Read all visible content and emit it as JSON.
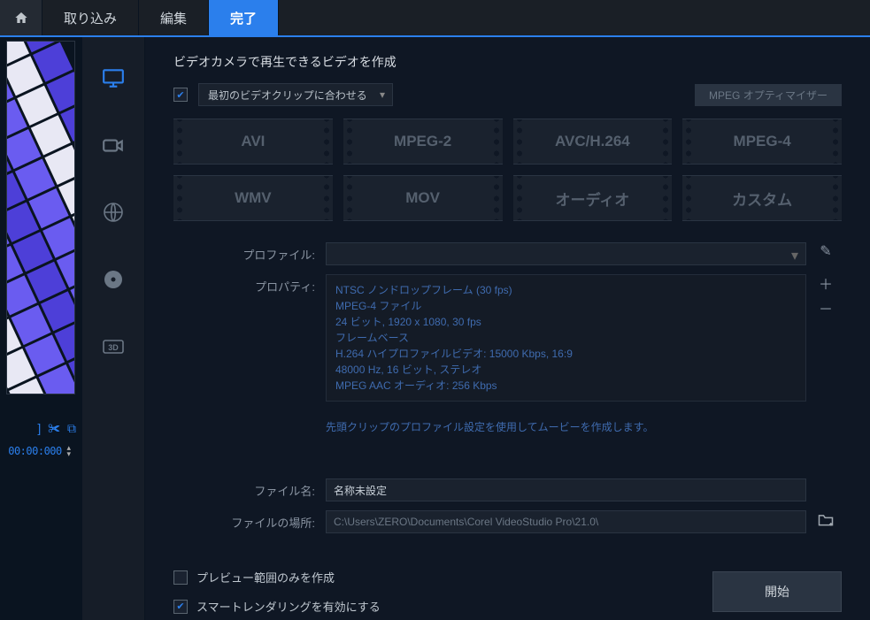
{
  "tabs": {
    "import": "取り込み",
    "edit": "編集",
    "finish": "完了"
  },
  "heading": "ビデオカメラで再生できるビデオを作成",
  "match_clip": {
    "label": "最初のビデオクリップに合わせる",
    "checked": true
  },
  "mpeg_opt": "MPEG オプティマイザー",
  "formats": [
    "AVI",
    "MPEG-2",
    "AVC/H.264",
    "MPEG-4",
    "WMV",
    "MOV",
    "オーディオ",
    "カスタム"
  ],
  "labels": {
    "profile": "プロファイル:",
    "properties": "プロパティ:",
    "filename": "ファイル名:",
    "filepath": "ファイルの場所:"
  },
  "properties_lines": [
    "NTSC ノンドロップフレーム (30 fps)",
    "MPEG-4 ファイル",
    "24 ビット, 1920 x 1080, 30 fps",
    "フレームベース",
    "H.264 ハイプロファイルビデオ: 15000 Kbps, 16:9",
    "48000 Hz, 16 ビット, ステレオ",
    "MPEG AAC オーディオ: 256 Kbps"
  ],
  "hint": "先頭クリップのプロファイル設定を使用してムービーを作成します。",
  "filename_value": "名称未設定",
  "filepath_value": "C:\\Users\\ZERO\\Documents\\Corel VideoStudio Pro\\21.0\\",
  "preview_only": {
    "label": "プレビュー範囲のみを作成",
    "checked": false
  },
  "smart_render": {
    "label": "スマートレンダリングを有効にする",
    "checked": true
  },
  "start": "開始",
  "timecode": "00:00:000",
  "icons": {
    "pencil": "✎",
    "plus": "＋",
    "minus": "－",
    "folder": "📁",
    "scissors": "✀",
    "cut": "⧉",
    "bracket": "]"
  }
}
